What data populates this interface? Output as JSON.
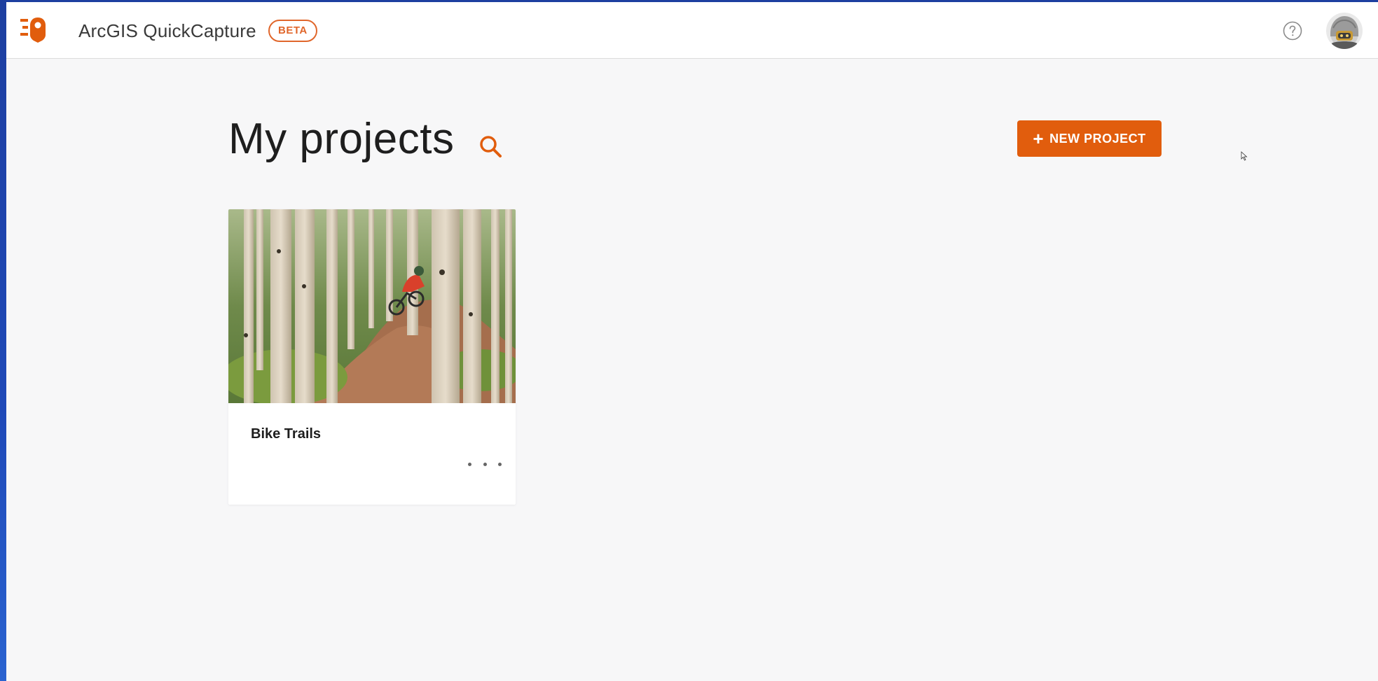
{
  "app": {
    "title": "ArcGIS QuickCapture",
    "badge": "BETA",
    "accent_color": "#e15d0d"
  },
  "header": {
    "logo_icon": "quickcapture-logo-icon",
    "help_icon": "help-circle-icon",
    "avatar_icon": "user-avatar"
  },
  "main": {
    "page_title": "My projects",
    "search_icon": "search-icon",
    "new_project_label": "NEW PROJECT",
    "new_project_icon": "plus-icon"
  },
  "projects": [
    {
      "title": "Bike Trails",
      "thumbnail": "mountain-biker-aspen-forest-photo",
      "menu_icon": "more-horizontal-icon"
    }
  ]
}
